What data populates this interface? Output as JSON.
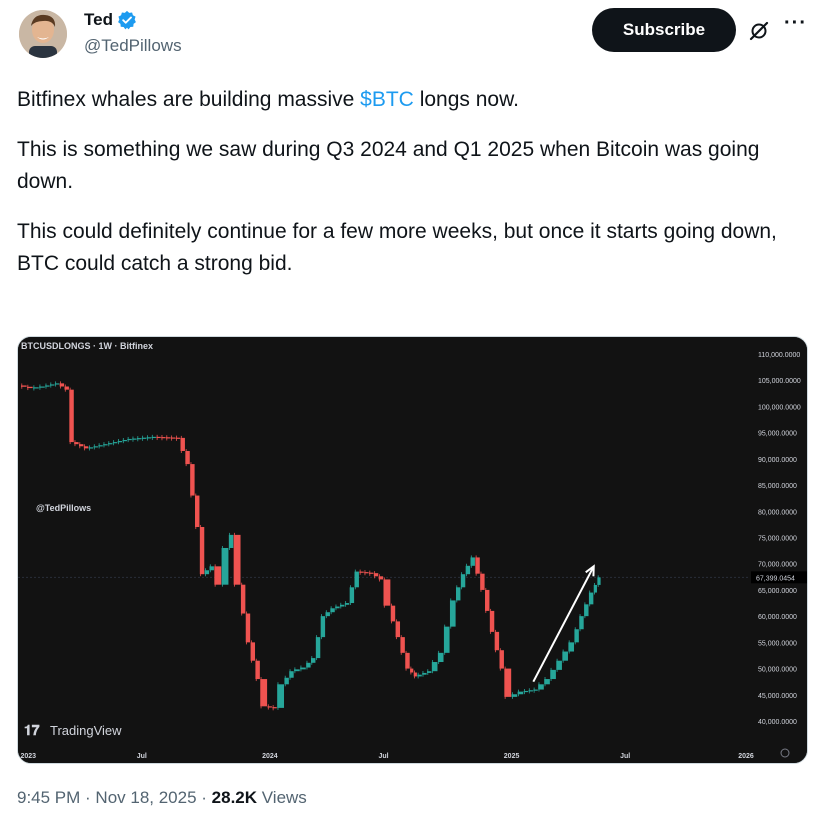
{
  "author": {
    "name": "Ted",
    "handle": "@TedPillows"
  },
  "actions": {
    "subscribe_label": "Subscribe",
    "more_label": "···"
  },
  "tweet": {
    "line1_pre": "Bitfinex whales are building massive ",
    "line1_cashtag": "$BTC",
    "line1_post": " longs now.",
    "paragraph2": "This is something we saw during Q3 2024 and Q1 2025 when Bitcoin was going down.",
    "paragraph3": "This could definitely continue for a few more weeks, but once it starts going down, BTC could catch a strong bid."
  },
  "chart_data": {
    "type": "line",
    "title": "BTCUSDLONGS · 1W · Bitfinex",
    "watermark": "@TedPillows",
    "brand": "TradingView",
    "x_ticks": [
      "2023",
      "Jul",
      "2024",
      "Jul",
      "2025",
      "Jul",
      "2026"
    ],
    "y_ticks": [
      "110,000.0000",
      "105,000.0000",
      "100,000.0000",
      "95,000.0000",
      "90,000.0000",
      "85,000.0000",
      "80,000.0000",
      "75,000.0000",
      "70,000.0000",
      "65,000.0000",
      "60,000.0000",
      "55,000.0000",
      "50,000.0000",
      "45,000.0000",
      "40,000.0000"
    ],
    "last_value_label": "67,399.0454",
    "ylim": [
      40000,
      110000
    ],
    "xlim": [
      2023.0,
      2026.0
    ],
    "colors": {
      "up": "#26a69a",
      "down": "#ef5350",
      "arrow": "#ffffff",
      "background": "#121212"
    },
    "points": [
      [
        2023.0,
        104000
      ],
      [
        2023.05,
        103500
      ],
      [
        2023.1,
        103800
      ],
      [
        2023.16,
        104400
      ],
      [
        2023.2,
        103200
      ],
      [
        2023.22,
        93200
      ],
      [
        2023.28,
        92000
      ],
      [
        2023.36,
        92800
      ],
      [
        2023.46,
        93800
      ],
      [
        2023.56,
        94200
      ],
      [
        2023.66,
        94000
      ],
      [
        2023.7,
        89000
      ],
      [
        2023.74,
        77000
      ],
      [
        2023.76,
        68000
      ],
      [
        2023.8,
        69500
      ],
      [
        2023.83,
        66000
      ],
      [
        2023.86,
        73000
      ],
      [
        2023.88,
        75500
      ],
      [
        2023.91,
        66000
      ],
      [
        2023.95,
        55000
      ],
      [
        2023.99,
        48000
      ],
      [
        2024.02,
        42800
      ],
      [
        2024.06,
        42500
      ],
      [
        2024.09,
        47000
      ],
      [
        2024.13,
        49500
      ],
      [
        2024.18,
        50200
      ],
      [
        2024.22,
        52000
      ],
      [
        2024.26,
        60000
      ],
      [
        2024.3,
        61500
      ],
      [
        2024.36,
        62500
      ],
      [
        2024.4,
        68500
      ],
      [
        2024.46,
        68200
      ],
      [
        2024.5,
        67000
      ],
      [
        2024.53,
        62000
      ],
      [
        2024.57,
        56000
      ],
      [
        2024.61,
        50000
      ],
      [
        2024.64,
        48500
      ],
      [
        2024.7,
        49500
      ],
      [
        2024.75,
        53000
      ],
      [
        2024.8,
        63000
      ],
      [
        2024.84,
        68000
      ],
      [
        2024.88,
        71200
      ],
      [
        2024.92,
        65000
      ],
      [
        2024.96,
        57000
      ],
      [
        2025.0,
        50000
      ],
      [
        2025.03,
        44600
      ],
      [
        2025.08,
        45600
      ],
      [
        2025.14,
        46000
      ],
      [
        2025.19,
        48000
      ],
      [
        2025.24,
        51500
      ],
      [
        2025.29,
        55000
      ],
      [
        2025.33,
        60000
      ],
      [
        2025.37,
        64500
      ],
      [
        2025.4,
        67400
      ]
    ]
  }
}
